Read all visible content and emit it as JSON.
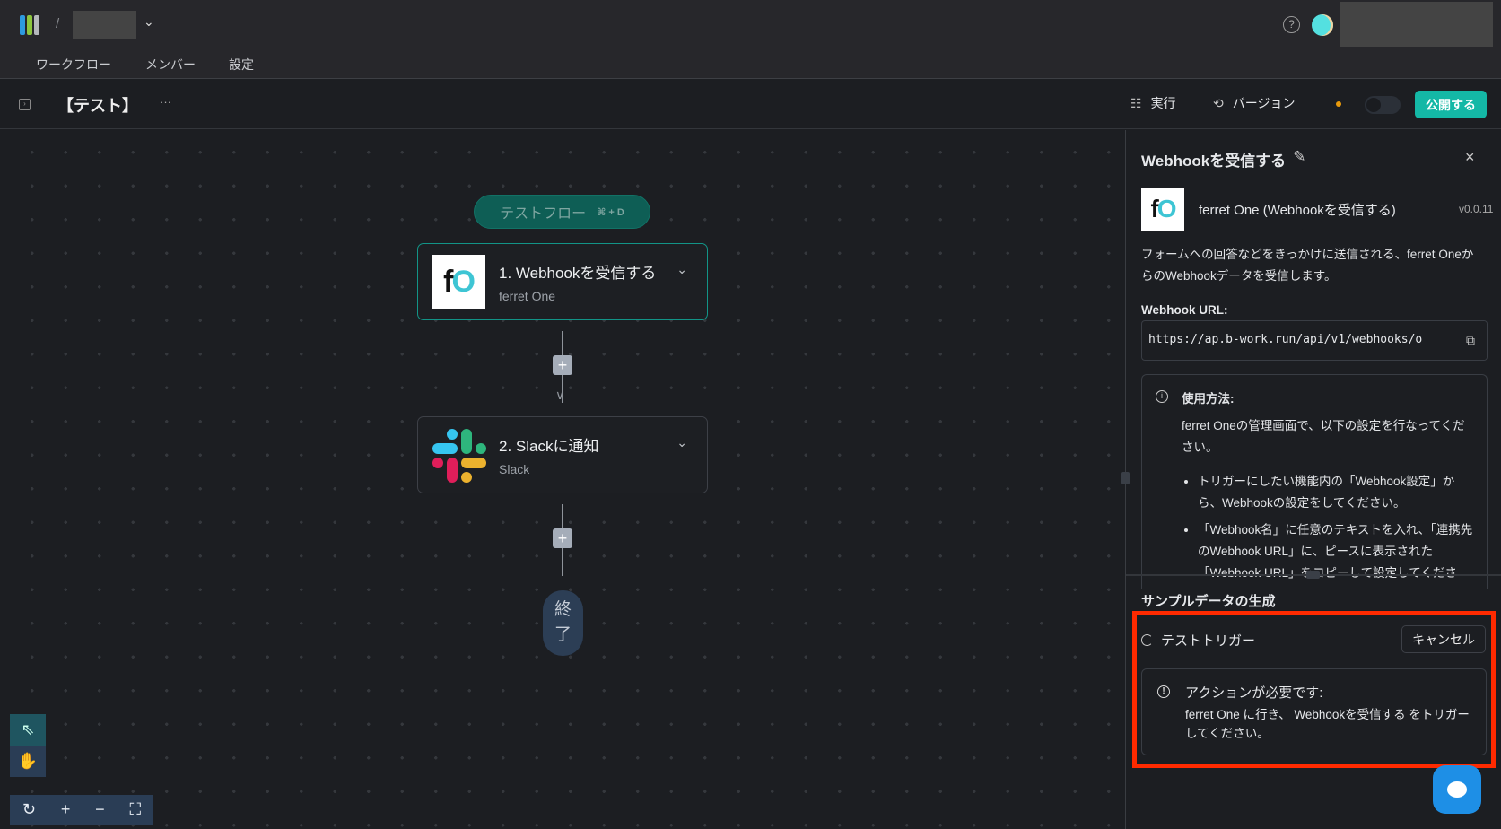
{
  "header": {
    "separator": "/",
    "tabs": [
      "ワークフロー",
      "メンバー",
      "設定"
    ],
    "help_icon": "question-circle-icon"
  },
  "toolbar": {
    "title": "【テスト】",
    "more": "···",
    "runs_label": "実行",
    "versions_label": "バージョン",
    "publish_label": "公開する",
    "status_dot_color": "#e89a0c",
    "accent": "#14b8a6"
  },
  "canvas": {
    "test_flow": {
      "label": "テストフロー",
      "shortcut": "⌘ + D"
    },
    "nodes": [
      {
        "title": "1. Webhookを受信する",
        "subtitle": "ferret One",
        "logo": "fO"
      },
      {
        "title": "2. Slackに通知",
        "subtitle": "Slack"
      }
    ],
    "end_label_1": "終",
    "end_label_2": "了"
  },
  "panel": {
    "title": "Webhookを受信する",
    "piece_name": "ferret One (Webhookを受信する)",
    "version": "v0.0.11",
    "description": "フォームへの回答などをきっかけに送信される、ferret OneからのWebhookデータを受信します。",
    "url_label": "Webhook URL:",
    "url_value": "https://ap.b-work.run/api/v1/webhooks/o",
    "usage_title": "使用方法:",
    "usage_text": "ferret Oneの管理画面で、以下の設定を行なってください。",
    "usage_steps": [
      "トリガーにしたい機能内の「Webhook設定」から、Webhookの設定をしてください。",
      "「Webhook名」に任意のテキストを入れ、「連携先のWebhook URL」に、ピースに表示された「Webhook URL」をコピーして設定してください。"
    ],
    "sample_title": "サンプルデータの生成",
    "trigger_label": "テストトリガー",
    "cancel_label": "キャンセル",
    "action_title": "アクションが必要です:",
    "action_text": "ferret One に行き、 Webhookを受信する をトリガーしてください。",
    "highlight_color": "#ff2a00"
  }
}
